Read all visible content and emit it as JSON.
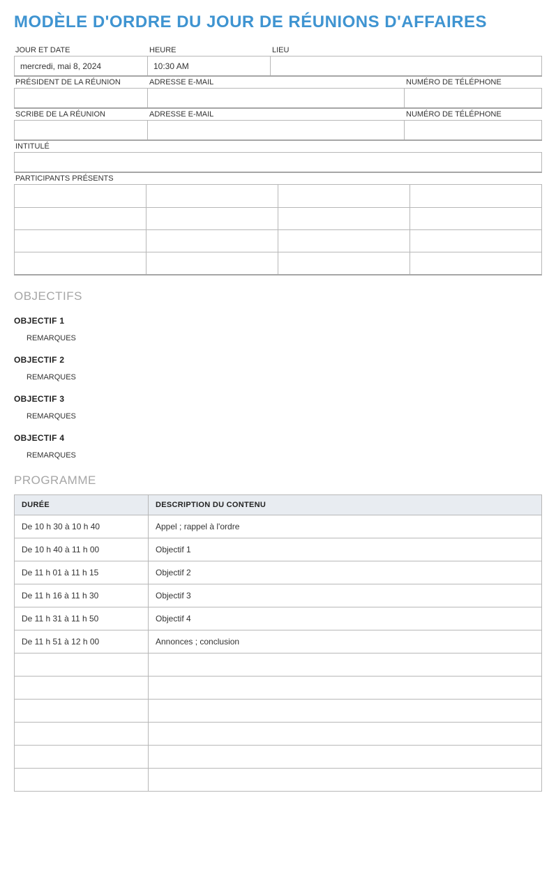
{
  "title": "MODÈLE D'ORDRE DU JOUR DE RÉUNIONS D'AFFAIRES",
  "labels": {
    "daydate": "JOUR ET DATE",
    "time": "HEURE",
    "place": "LIEU",
    "president": "PRÉSIDENT DE LA RÉUNION",
    "email": "ADRESSE E-MAIL",
    "phone": "NUMÉRO DE TÉLÉPHONE",
    "scribe": "SCRIBE DE LA RÉUNION",
    "intitule": "INTITULÉ",
    "participants": "PARTICIPANTS PRÉSENTS"
  },
  "values": {
    "daydate": "mercredi, mai 8, 2024",
    "time": "10:30 AM",
    "place": "",
    "president_name": "",
    "president_email": "",
    "president_phone": "",
    "scribe_name": "",
    "scribe_email": "",
    "scribe_phone": "",
    "intitule": ""
  },
  "sections": {
    "objectifs": "OBJECTIFS",
    "programme": "PROGRAMME"
  },
  "objectifs": [
    {
      "title": "OBJECTIF 1",
      "remark": "REMARQUES"
    },
    {
      "title": "OBJECTIF 2",
      "remark": "REMARQUES"
    },
    {
      "title": "OBJECTIF 3",
      "remark": "REMARQUES"
    },
    {
      "title": "OBJECTIF 4",
      "remark": "REMARQUES"
    }
  ],
  "programme": {
    "headers": {
      "duree": "DURÉE",
      "desc": "DESCRIPTION DU CONTENU"
    },
    "rows": [
      {
        "duree": "De 10 h 30 à 10 h 40",
        "desc": "Appel ; rappel à l'ordre"
      },
      {
        "duree": "De 10 h 40 à 11 h 00",
        "desc": "Objectif 1"
      },
      {
        "duree": "De 11 h 01 à 11 h 15",
        "desc": "Objectif 2"
      },
      {
        "duree": "De 11 h 16 à 11 h 30",
        "desc": "Objectif 3"
      },
      {
        "duree": "De 11 h 31 à 11 h 50",
        "desc": "Objectif 4"
      },
      {
        "duree": "De 11 h 51 à 12 h 00",
        "desc": "Annonces ; conclusion"
      },
      {
        "duree": "",
        "desc": ""
      },
      {
        "duree": "",
        "desc": ""
      },
      {
        "duree": "",
        "desc": ""
      },
      {
        "duree": "",
        "desc": ""
      },
      {
        "duree": "",
        "desc": ""
      },
      {
        "duree": "",
        "desc": ""
      }
    ]
  }
}
